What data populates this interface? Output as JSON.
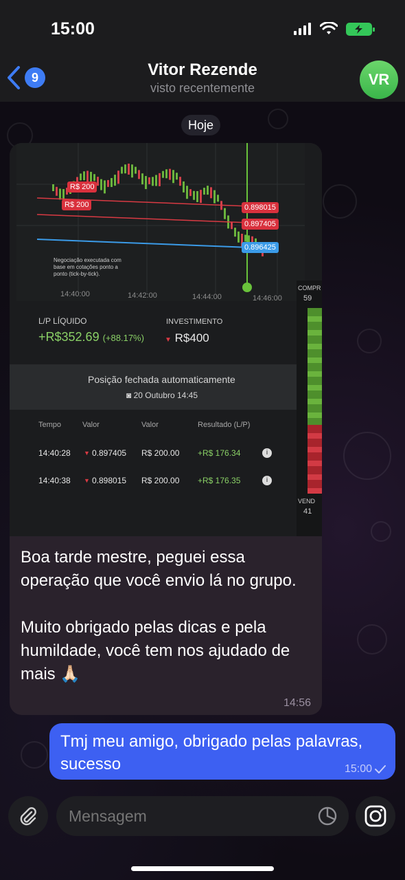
{
  "status_bar": {
    "time": "15:00"
  },
  "header": {
    "back_badge": "9",
    "contact_name": "Vitor Rezende",
    "last_seen": "visto recentemente",
    "avatar_initials": "VR"
  },
  "chat": {
    "date_divider": "Hoje",
    "incoming": {
      "photo": {
        "price_tags": [
          "R$ 200",
          "R$ 200"
        ],
        "line_values": [
          "0.898015",
          "0.897405",
          "0.896425"
        ],
        "note": "Negociação executada com base em cotações ponto a ponto (tick-by-tick).",
        "time_axis": [
          "14:40:00",
          "14:42:00",
          "14:44:00",
          "14:46:00"
        ],
        "pl_label": "L/P LÍQUIDO",
        "pl_value": "+R$352.69",
        "pl_percent": "(+88.17%)",
        "invest_label": "INVESTIMENTO",
        "invest_value": "R$400",
        "closed_title": "Posição fechada automaticamente",
        "closed_date": "20 Outubro 14:45",
        "table_headers": [
          "Tempo",
          "Valor",
          "Valor",
          "Resultado (L/P)"
        ],
        "rows": [
          {
            "time": "14:40:28",
            "rate": "0.897405",
            "amount": "R$ 200.00",
            "result": "+R$ 176.34"
          },
          {
            "time": "14:40:38",
            "rate": "0.898015",
            "amount": "R$ 200.00",
            "result": "+R$ 176.35"
          }
        ],
        "side_top_label": "COMPR",
        "side_top_value": "59",
        "side_bottom_label": "VEND",
        "side_bottom_value": "41"
      },
      "text": "Boa tarde mestre, peguei essa operação que você envio lá no grupo.\n\nMuito obrigado pelas dicas e pela humildade, você tem nos ajudado de mais 🙏🏻",
      "time": "14:56"
    },
    "outgoing": {
      "text": "Tmj meu amigo, obrigado pelas palavras, sucesso",
      "time": "15:00"
    }
  },
  "input": {
    "placeholder": "Mensagem"
  },
  "colors": {
    "accent": "#3d60f2",
    "incoming_bubble": "#2a222c",
    "avatar": "#3ab54a"
  }
}
